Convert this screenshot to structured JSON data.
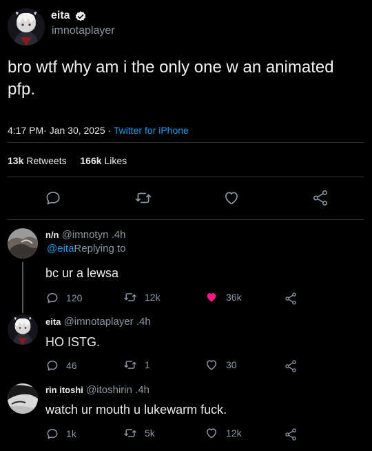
{
  "main_tweet": {
    "display_name": "eita",
    "handle": "imnotaplayer",
    "text": "bro wtf why am i the only one w an animated pfp.",
    "time": "4:17 PM·",
    "date": "Jan 30, 2025 ·",
    "source": "Twitter for iPhone",
    "retweets_count": "13k",
    "retweets_label": "Retweets",
    "likes_count": "166k",
    "likes_label": "Likes"
  },
  "replies": [
    {
      "display_name": "n/n",
      "handle": "@imnotyn",
      "time": ".4h",
      "replying_mention": "@eita",
      "replying_text": "Replying to",
      "text": "bc ur a lewsa",
      "replies": "120",
      "retweets": "12k",
      "likes": "36k",
      "liked": true
    },
    {
      "display_name": "eita",
      "handle": "@imnotaplayer",
      "time": ".4h",
      "text": "HO ISTG.",
      "replies": "46",
      "retweets": "1",
      "likes": "30",
      "liked": false
    },
    {
      "display_name": "rin itoshi",
      "handle": "@itoshirin",
      "time": ".4h",
      "text": "watch ur mouth u lukewarm fuck.",
      "replies": "1k",
      "retweets": "5k",
      "likes": "12k",
      "liked": false
    }
  ],
  "colors": {
    "background": "#000000",
    "text": "#e7e9ea",
    "muted": "#8b98a5",
    "link": "#1d9bf0",
    "like_active": "#f91880",
    "divider": "#2f3336"
  },
  "icons": [
    "verified-badge-icon",
    "reply-icon",
    "retweet-icon",
    "like-icon",
    "share-icon"
  ]
}
